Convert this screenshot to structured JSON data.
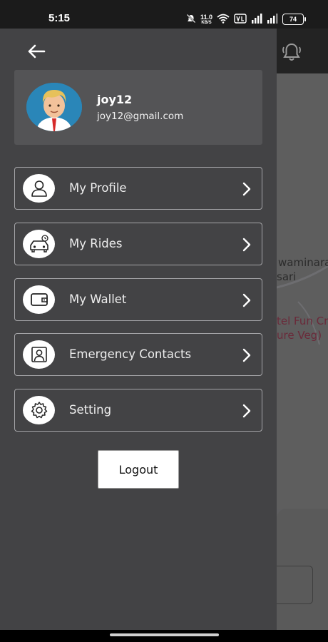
{
  "status_bar": {
    "time": "5:15",
    "net_speed_value": "11.0",
    "net_speed_unit": "KB/S",
    "battery": "74"
  },
  "background": {
    "map_labels": [
      "waminara",
      "sari",
      "tel Fun Cr",
      "ure Veg)"
    ]
  },
  "profile": {
    "username": "joy12",
    "email": "joy12@gmail.com"
  },
  "menu": {
    "items": [
      {
        "label": "My Profile",
        "icon": "user-icon"
      },
      {
        "label": "My Rides",
        "icon": "car-icon"
      },
      {
        "label": "My Wallet",
        "icon": "wallet-icon"
      },
      {
        "label": "Emergency Contacts",
        "icon": "contact-card-icon"
      },
      {
        "label": "Setting",
        "icon": "gear-icon"
      }
    ]
  },
  "logout_label": "Logout",
  "colors": {
    "drawer_bg": "#434345",
    "profile_card_bg": "#545456",
    "menu_border": "#a5a5a8",
    "avatar_bg": "#2a86b8"
  }
}
